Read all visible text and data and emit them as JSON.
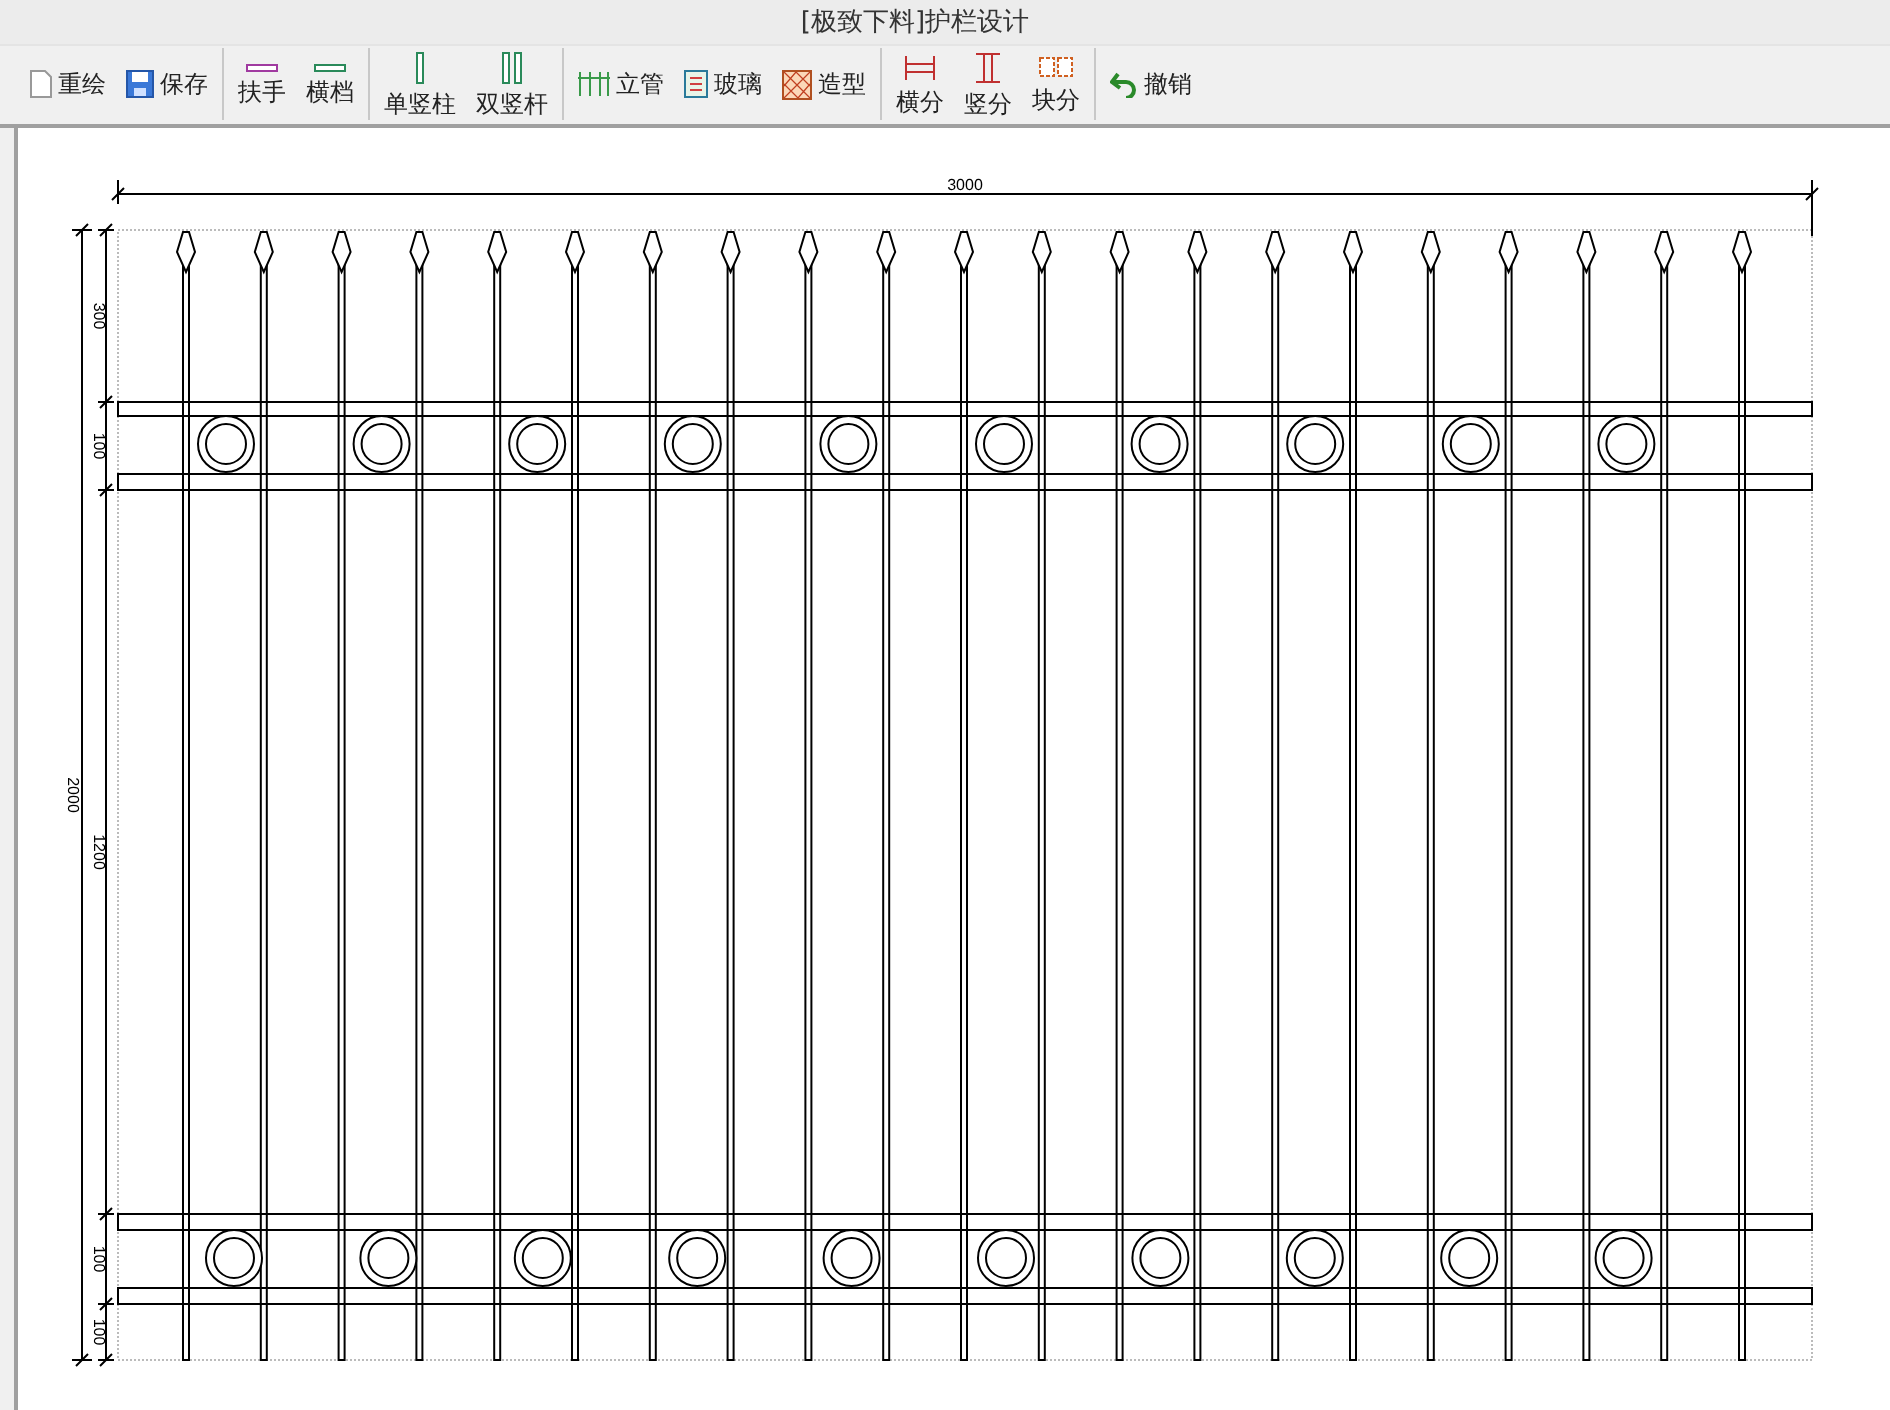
{
  "window": {
    "title": "[极致下料]护栏设计"
  },
  "toolbar": [
    [
      {
        "label": "重绘",
        "kind": "inline"
      },
      {
        "label": "保存",
        "kind": "inline"
      }
    ],
    [
      {
        "label": "扶手",
        "kind": "stacked"
      },
      {
        "label": "横档",
        "kind": "stacked"
      }
    ],
    [
      {
        "label": "单竖柱",
        "kind": "stacked"
      },
      {
        "label": "双竖杆",
        "kind": "stacked"
      }
    ],
    [
      {
        "label": "立管",
        "kind": "inline"
      },
      {
        "label": "玻璃",
        "kind": "inline"
      },
      {
        "label": "造型",
        "kind": "inline"
      }
    ],
    [
      {
        "label": "横分",
        "kind": "stacked"
      },
      {
        "label": "竖分",
        "kind": "stacked"
      },
      {
        "label": "块分",
        "kind": "stacked"
      }
    ],
    [
      {
        "label": "撤销",
        "kind": "inline"
      }
    ]
  ],
  "drawing": {
    "width_dimension": "3000",
    "height_dimension": "2000",
    "segment_dimensions": [
      "300",
      "100",
      "1200",
      "100",
      "100"
    ]
  }
}
